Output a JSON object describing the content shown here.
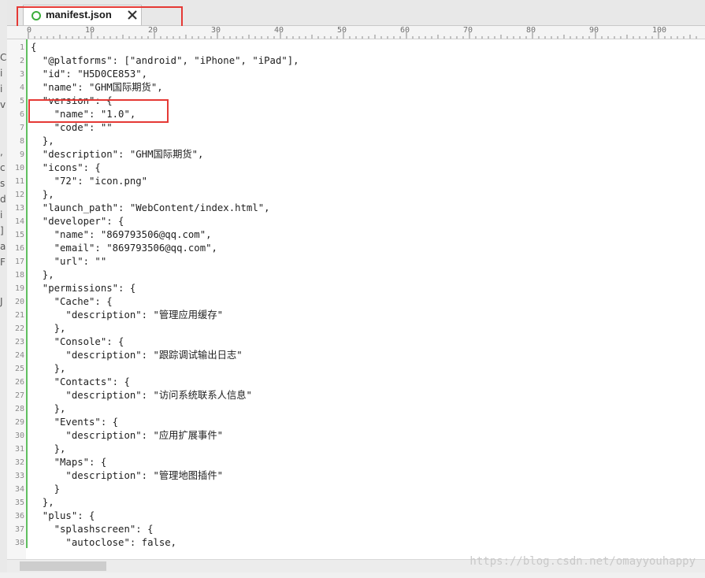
{
  "tab": {
    "title": "manifest.json",
    "close_symbol": "✕"
  },
  "icons": {
    "tab_file": "file-status-icon",
    "tab_close": "close-icon"
  },
  "colors": {
    "highlight_box": "#e53935",
    "change_bar": "#5fbf5f",
    "file_status": "#3cae3c"
  },
  "ruler": {
    "labels": [
      "0",
      "10",
      "20",
      "30",
      "40",
      "50",
      "60",
      "70",
      "80",
      "90",
      "100"
    ]
  },
  "side_strip_chars": [
    "C",
    "i",
    "i",
    "v",
    ",",
    "c",
    "s",
    "d",
    "i",
    "]",
    "a",
    "F",
    "J"
  ],
  "editor": {
    "lines": [
      {
        "n": "1",
        "text": "{"
      },
      {
        "n": "2",
        "text": "  \"@platforms\": [\"android\", \"iPhone\", \"iPad\"],"
      },
      {
        "n": "3",
        "text": "  \"id\": \"H5D0CE853\","
      },
      {
        "n": "4",
        "text": "  \"name\": \"GHM国际期货\","
      },
      {
        "n": "5",
        "text": "  \"version\": {"
      },
      {
        "n": "6",
        "text": "    \"name\": \"1.0\","
      },
      {
        "n": "7",
        "text": "    \"code\": \"\""
      },
      {
        "n": "8",
        "text": "  },"
      },
      {
        "n": "9",
        "text": "  \"description\": \"GHM国际期货\","
      },
      {
        "n": "10",
        "text": "  \"icons\": {"
      },
      {
        "n": "11",
        "text": "    \"72\": \"icon.png\""
      },
      {
        "n": "12",
        "text": "  },"
      },
      {
        "n": "13",
        "text": "  \"launch_path\": \"WebContent/index.html\","
      },
      {
        "n": "14",
        "text": "  \"developer\": {"
      },
      {
        "n": "15",
        "text": "    \"name\": \"869793506@qq.com\","
      },
      {
        "n": "16",
        "text": "    \"email\": \"869793506@qq.com\","
      },
      {
        "n": "17",
        "text": "    \"url\": \"\""
      },
      {
        "n": "18",
        "text": "  },"
      },
      {
        "n": "19",
        "text": "  \"permissions\": {"
      },
      {
        "n": "20",
        "text": "    \"Cache\": {"
      },
      {
        "n": "21",
        "text": "      \"description\": \"管理应用缓存\""
      },
      {
        "n": "22",
        "text": "    },"
      },
      {
        "n": "23",
        "text": "    \"Console\": {"
      },
      {
        "n": "24",
        "text": "      \"description\": \"跟踪调试输出日志\""
      },
      {
        "n": "25",
        "text": "    },"
      },
      {
        "n": "26",
        "text": "    \"Contacts\": {"
      },
      {
        "n": "27",
        "text": "      \"description\": \"访问系统联系人信息\""
      },
      {
        "n": "28",
        "text": "    },"
      },
      {
        "n": "29",
        "text": "    \"Events\": {"
      },
      {
        "n": "30",
        "text": "      \"description\": \"应用扩展事件\""
      },
      {
        "n": "31",
        "text": "    },"
      },
      {
        "n": "32",
        "text": "    \"Maps\": {"
      },
      {
        "n": "33",
        "text": "      \"description\": \"管理地图插件\""
      },
      {
        "n": "34",
        "text": "    }"
      },
      {
        "n": "35",
        "text": "  },"
      },
      {
        "n": "36",
        "text": "  \"plus\": {"
      },
      {
        "n": "37",
        "text": "    \"splashscreen\": {"
      },
      {
        "n": "38",
        "text": "      \"autoclose\": false,"
      }
    ]
  },
  "watermark": "https://blog.csdn.net/omayyouhappy"
}
